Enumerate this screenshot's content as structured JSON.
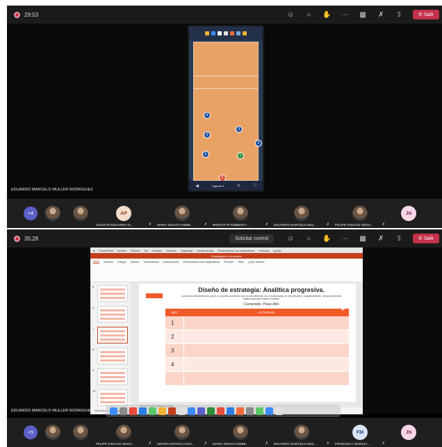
{
  "screen1": {
    "timer": "29:53",
    "leave_label": "Salir",
    "presenter_name": "EDUARDO MARCELO MULLER RODRIGUEZ",
    "overflow_count": "+4",
    "phone": {
      "top_badge": "0 - 3",
      "setter_label": "Jugador 4"
    },
    "participants": [
      {
        "initials": "",
        "name": "",
        "kind": "photo"
      },
      {
        "initials": "",
        "name": "",
        "kind": "photo"
      },
      {
        "initials": "AP",
        "name": "AGUSTIN EDUARDO G...",
        "kind": "initials"
      },
      {
        "initials": "",
        "name": "MARIA IGNACIA REBE...",
        "kind": "photo"
      },
      {
        "initials": "",
        "name": "BRIGGITTE KIMBERLY ...",
        "kind": "photo"
      },
      {
        "initials": "",
        "name": "EDUARDO MARCELO MUL...",
        "kind": "photo"
      },
      {
        "initials": "",
        "name": "FELIPE IGNACIO SEGO...",
        "kind": "photo"
      },
      {
        "initials": "JN",
        "name": "",
        "kind": "initials"
      }
    ]
  },
  "screen2": {
    "timer": "35:28",
    "leave_label": "Salir",
    "control_label": "Solicitar control",
    "presenter_name": "EDUARDO MARCELO MULLER RODRIGUEZ",
    "overflow_count": "+5",
    "ppt": {
      "mac_menu": [
        "PowerPoint",
        "Archivo",
        "Edición",
        "Ver",
        "Insertar",
        "Formato",
        "Organizar",
        "Herramientas",
        "Presentación con diapositivas",
        "Ventana",
        "Ayuda"
      ],
      "doc_title": "Estrategias en la presión",
      "tabs": [
        "Inicio",
        "Insertar",
        "Dibujar",
        "Diseño",
        "Transiciones",
        "Animaciones",
        "Presentación con diapositivas",
        "Revisar",
        "Vista",
        "¿Qué desea?"
      ],
      "slide_title": "Diseño de estrategia:  Analítica progresiva.",
      "slide_subtitle": "La tarea se desarrollará en partes. La práctica comienza con un solo elemento, uno va dominando en este ejecutivo, progresivamente, nuevos elementos hasta la ejecución total de la tarea.",
      "slide_content": "Contenido: Pase Alto",
      "table_headers": [
        "SEC",
        "ACTIVIDAD"
      ],
      "table_rows": [
        "1",
        "2",
        "3",
        "4"
      ],
      "notes_placeholder": "Haz clic para agregar notas",
      "status_text": "Diapositiva 6 de 15   Español (Chile)",
      "thumb_numbers": [
        "5",
        "6",
        "7",
        "8",
        "9",
        "10"
      ]
    },
    "participants": [
      {
        "initials": "",
        "name": "",
        "kind": "photo"
      },
      {
        "initials": "",
        "name": "",
        "kind": "photo"
      },
      {
        "initials": "",
        "name": "FELIPE IGNACIO SEGO...",
        "kind": "photo"
      },
      {
        "initials": "",
        "name": "SERGIO MATIAS OJOS...",
        "kind": "photo"
      },
      {
        "initials": "",
        "name": "MARIA IGNACIA REBE...",
        "kind": "photo"
      },
      {
        "initials": "",
        "name": "EDUARDO MARCELO MUL...",
        "kind": "photo"
      },
      {
        "initials": "FM",
        "name": "FRANCISCA IGNACIA ...",
        "kind": "initials"
      },
      {
        "initials": "JN",
        "name": "",
        "kind": "initials"
      }
    ]
  },
  "colors": {
    "leave": "#c4314b",
    "court": "#e9a265",
    "ppt_accent": "#f05a28",
    "team_purple": "#5b5fc7"
  },
  "icons": [
    "people-icon",
    "chat-icon",
    "reactions-icon",
    "more-icon",
    "camera-off-icon",
    "mic-off-icon",
    "share-icon",
    "phone-icon"
  ]
}
